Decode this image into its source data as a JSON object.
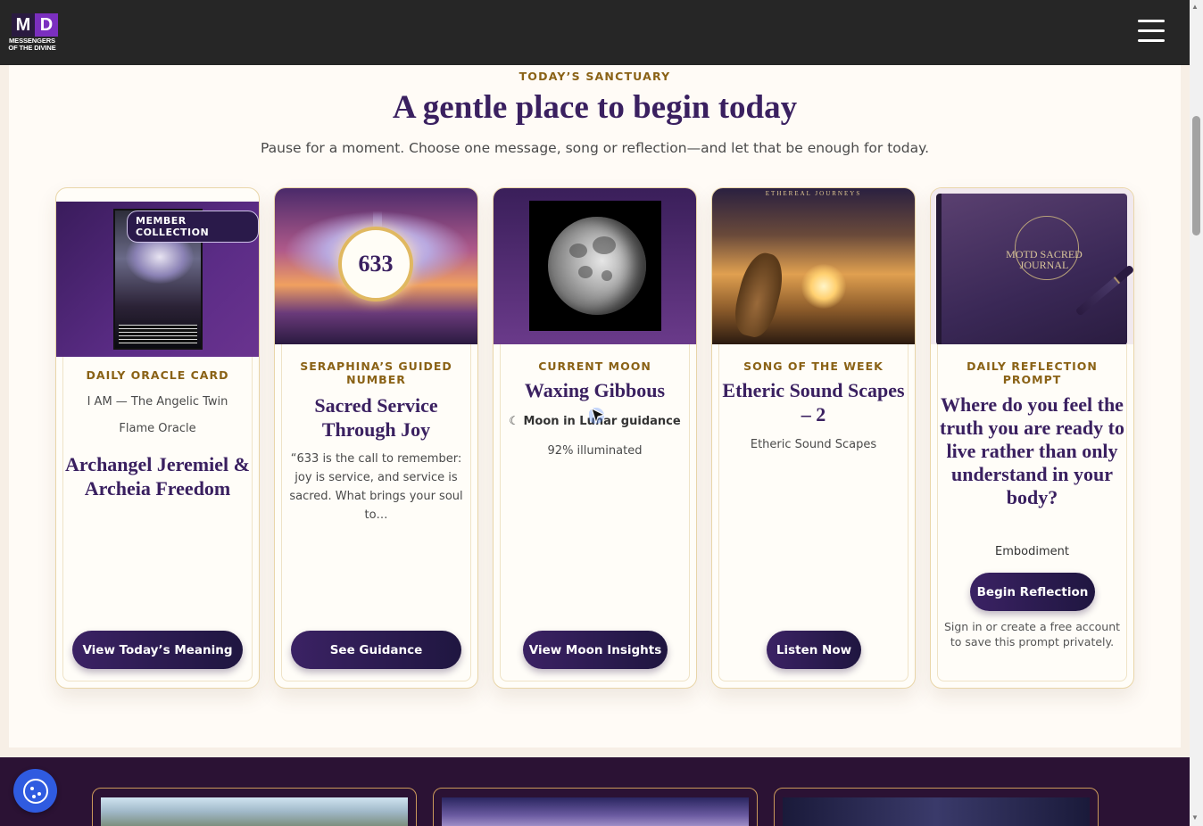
{
  "header": {
    "logo_initials_m": "M",
    "logo_initials_d": "D",
    "logo_text_line1": "MESSENGERS",
    "logo_text_line2": "OF THE DIVINE"
  },
  "sanctuary": {
    "eyebrow": "TODAY’S SANCTUARY",
    "heading": "A gentle place to begin today",
    "subheading": "Pause for a moment. Choose one message, song or reflection—and let that be enough for today."
  },
  "cards": [
    {
      "badge": "MEMBER COLLECTION",
      "label": "DAILY ORACLE CARD",
      "subtitle": "I AM — The Angelic Twin Flame Oracle",
      "title": "Archangel Jeremiel & Archeia Freedom",
      "button": "View Today’s Meaning"
    },
    {
      "number": "633",
      "label": "SERAPHINA’S GUIDED NUMBER",
      "title": "Sacred Service Through Joy",
      "text": "“633 is the call to remember: joy is service, and service is sacred. What brings your soul to…",
      "button": "See Guidance"
    },
    {
      "label": "CURRENT MOON",
      "title": "Waxing Gibbous",
      "guidance_icon": "☾",
      "guidance": "Moon in Lunar guidance",
      "illumination": "92% illuminated",
      "button": "View Moon Insights"
    },
    {
      "image_caption": "ETHEREAL JOURNEYS",
      "label": "SONG OF THE WEEK",
      "title": "Etheric Sound Scapes – 2",
      "subtitle": "Etheric Sound Scapes",
      "button": "Listen Now"
    },
    {
      "journal_title": "MOTD SACRED JOURNAL",
      "label": "DAILY REFLECTION PROMPT",
      "title": "Where do you feel the truth you are ready to live rather than only understand in your body?",
      "category": "Embodiment",
      "button": "Begin Reflection",
      "footnote": "Sign in or create a free account to save this prompt privately."
    }
  ],
  "icons": {
    "menu": "hamburger-menu-icon",
    "cookie": "cookie-icon",
    "cursor": "mouse-pointer-icon"
  },
  "colors": {
    "brand_purple": "#3a2060",
    "gold_label": "#8a6216",
    "header_bg": "#262626",
    "band_bg": "#2b1234",
    "cookie_blue": "#2f5be0"
  }
}
